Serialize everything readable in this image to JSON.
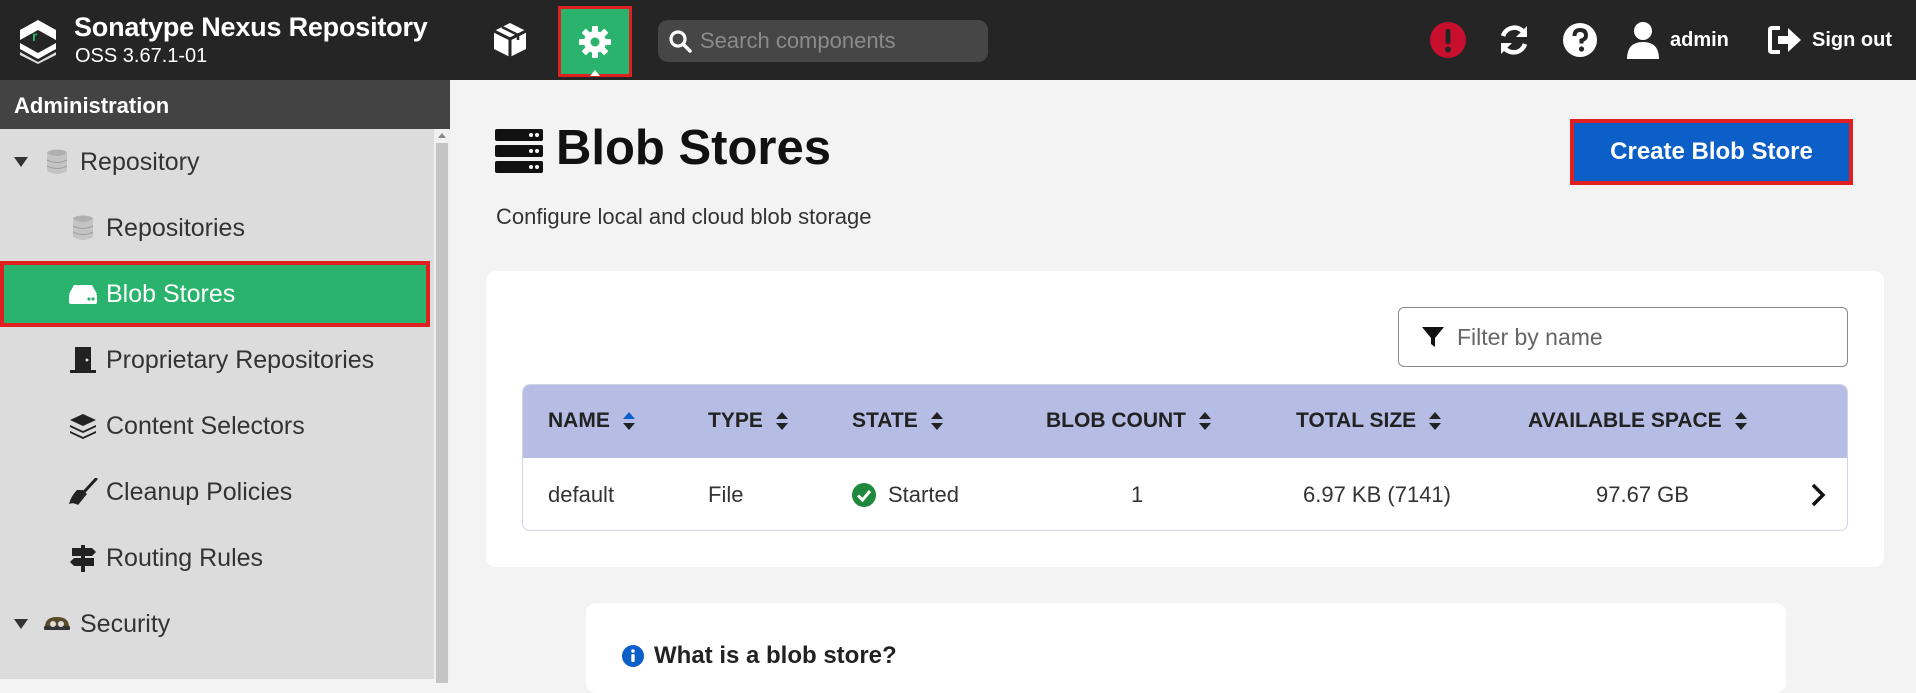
{
  "header": {
    "brand_title": "Sonatype Nexus Repository",
    "brand_version": "OSS 3.67.1-01",
    "search_placeholder": "Search components",
    "user_label": "admin",
    "signout_label": "Sign out",
    "icons": [
      "nexus-logo",
      "cube-icon",
      "gear-icon",
      "search-icon",
      "alert-icon",
      "refresh-icon",
      "help-icon",
      "user-icon",
      "sign-out-icon"
    ]
  },
  "sidebar": {
    "title": "Administration",
    "items": [
      {
        "label": "Repository",
        "type": "group",
        "expanded": true,
        "icon": "database-icon"
      },
      {
        "label": "Repositories",
        "type": "child",
        "icon": "database-icon"
      },
      {
        "label": "Blob Stores",
        "type": "child",
        "icon": "hard-drive-icon",
        "active": true
      },
      {
        "label": "Proprietary Repositories",
        "type": "child",
        "icon": "door-icon"
      },
      {
        "label": "Content Selectors",
        "type": "child",
        "icon": "layers-icon"
      },
      {
        "label": "Cleanup Policies",
        "type": "child",
        "icon": "broom-icon"
      },
      {
        "label": "Routing Rules",
        "type": "child",
        "icon": "signpost-icon"
      },
      {
        "label": "Security",
        "type": "group",
        "expanded": true,
        "icon": "security-icon"
      }
    ]
  },
  "main": {
    "title": "Blob Stores",
    "subtitle": "Configure local and cloud blob storage",
    "create_button": "Create Blob Store",
    "filter_placeholder": "Filter by name",
    "table": {
      "columns": [
        "NAME",
        "TYPE",
        "STATE",
        "BLOB COUNT",
        "TOTAL SIZE",
        "AVAILABLE SPACE"
      ],
      "rows": [
        {
          "name": "default",
          "type": "File",
          "state": "Started",
          "blob_count": "1",
          "total_size": "6.97 KB (7141)",
          "available_space": "97.67 GB"
        }
      ]
    },
    "info_title": "What is a blob store?"
  },
  "colors": {
    "header_bg": "#252525",
    "accent_green": "#29b36d",
    "primary_blue": "#0b5fc7",
    "table_header": "#b5bde4",
    "highlight_red": "#e02020",
    "alert_red": "#c8102e"
  }
}
